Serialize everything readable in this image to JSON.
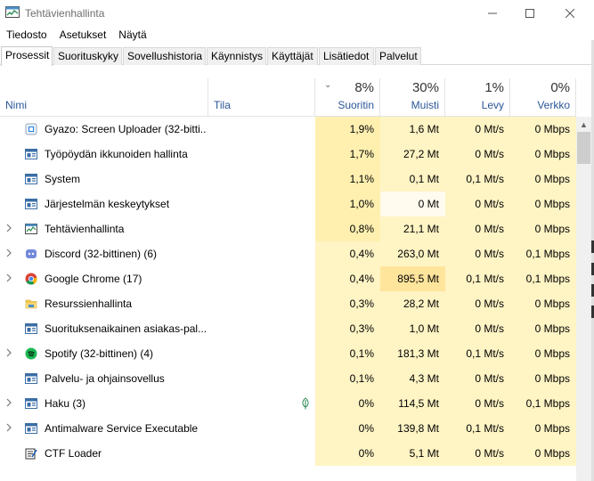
{
  "window": {
    "title": "Tehtävienhallinta"
  },
  "menu": [
    "Tiedosto",
    "Asetukset",
    "Näytä"
  ],
  "tabs": [
    "Prosessit",
    "Suorituskyky",
    "Sovellushistoria",
    "Käynnistys",
    "Käyttäjät",
    "Lisätiedot",
    "Palvelut"
  ],
  "columns": {
    "name": "Nimi",
    "status": "Tila",
    "cpu": {
      "pct": "8%",
      "label": "Suoritin"
    },
    "mem": {
      "pct": "30%",
      "label": "Muisti"
    },
    "disk": {
      "pct": "1%",
      "label": "Levy"
    },
    "net": {
      "pct": "0%",
      "label": "Verkko"
    }
  },
  "processes": [
    {
      "name": "Gyazo: Screen Uploader (32-bitti...",
      "icon": "gyazo-icon",
      "expandable": false,
      "cpu": "1,9%",
      "mem": "1,6 Mt",
      "disk": "0 Mt/s",
      "net": "0 Mbps",
      "heat": [
        2,
        1,
        1,
        1
      ]
    },
    {
      "name": "Työpöydän ikkunoiden hallinta",
      "icon": "window-app-icon",
      "expandable": false,
      "cpu": "1,7%",
      "mem": "27,2 Mt",
      "disk": "0 Mt/s",
      "net": "0 Mbps",
      "heat": [
        2,
        1,
        1,
        1
      ]
    },
    {
      "name": "System",
      "icon": "window-app-icon",
      "expandable": false,
      "cpu": "1,1%",
      "mem": "0,1 Mt",
      "disk": "0,1 Mt/s",
      "net": "0 Mbps",
      "heat": [
        2,
        1,
        1,
        1
      ]
    },
    {
      "name": "Järjestelmän keskeytykset",
      "icon": "window-app-icon",
      "expandable": false,
      "cpu": "1,0%",
      "mem": "0 Mt",
      "disk": "0 Mt/s",
      "net": "0 Mbps",
      "heat": [
        2,
        0,
        1,
        1
      ]
    },
    {
      "name": "Tehtävienhallinta",
      "icon": "task-manager-icon",
      "expandable": true,
      "cpu": "0,8%",
      "mem": "21,1 Mt",
      "disk": "0 Mt/s",
      "net": "0 Mbps",
      "heat": [
        2,
        1,
        1,
        1
      ]
    },
    {
      "name": "Discord (32-bittinen) (6)",
      "icon": "discord-icon",
      "expandable": true,
      "cpu": "0,4%",
      "mem": "263,0 Mt",
      "disk": "0 Mt/s",
      "net": "0,1 Mbps",
      "heat": [
        1,
        1,
        1,
        1
      ]
    },
    {
      "name": "Google Chrome (17)",
      "icon": "chrome-icon",
      "expandable": true,
      "cpu": "0,4%",
      "mem": "895,5 Mt",
      "disk": "0,1 Mt/s",
      "net": "0,1 Mbps",
      "heat": [
        1,
        3,
        1,
        1
      ]
    },
    {
      "name": "Resurssienhallinta",
      "icon": "folder-icon",
      "expandable": false,
      "cpu": "0,3%",
      "mem": "28,2 Mt",
      "disk": "0 Mt/s",
      "net": "0 Mbps",
      "heat": [
        1,
        1,
        1,
        1
      ]
    },
    {
      "name": "Suorituksenaikainen asiakas-pal...",
      "icon": "window-app-icon",
      "expandable": false,
      "cpu": "0,3%",
      "mem": "1,0 Mt",
      "disk": "0 Mt/s",
      "net": "0 Mbps",
      "heat": [
        1,
        1,
        1,
        1
      ]
    },
    {
      "name": "Spotify (32-bittinen) (4)",
      "icon": "spotify-icon",
      "expandable": true,
      "cpu": "0,1%",
      "mem": "181,3 Mt",
      "disk": "0,1 Mt/s",
      "net": "0 Mbps",
      "heat": [
        1,
        1,
        1,
        1
      ]
    },
    {
      "name": "Palvelu- ja ohjainsovellus",
      "icon": "window-app-icon",
      "expandable": false,
      "cpu": "0,1%",
      "mem": "4,3 Mt",
      "disk": "0 Mt/s",
      "net": "0 Mbps",
      "heat": [
        1,
        1,
        1,
        1
      ]
    },
    {
      "name": "Haku (3)",
      "icon": "window-app-icon",
      "expandable": true,
      "status_icon": "leaf-icon",
      "cpu": "0%",
      "mem": "114,5 Mt",
      "disk": "0 Mt/s",
      "net": "0,1 Mbps",
      "heat": [
        1,
        1,
        1,
        1
      ]
    },
    {
      "name": "Antimalware Service Executable",
      "icon": "window-app-icon",
      "expandable": true,
      "cpu": "0%",
      "mem": "139,8 Mt",
      "disk": "0,1 Mt/s",
      "net": "0 Mbps",
      "heat": [
        1,
        1,
        1,
        1
      ]
    },
    {
      "name": "CTF Loader",
      "icon": "ctf-icon",
      "expandable": false,
      "cpu": "0%",
      "mem": "5,1 Mt",
      "disk": "0 Mt/s",
      "net": "0 Mbps",
      "heat": [
        1,
        1,
        1,
        1
      ]
    }
  ],
  "colors": {
    "heat0": "#fffbee",
    "heat1": "#fff4c4",
    "heat2": "#fff0b0",
    "heat3": "#ffe59c",
    "header_label": "#2b5797"
  }
}
